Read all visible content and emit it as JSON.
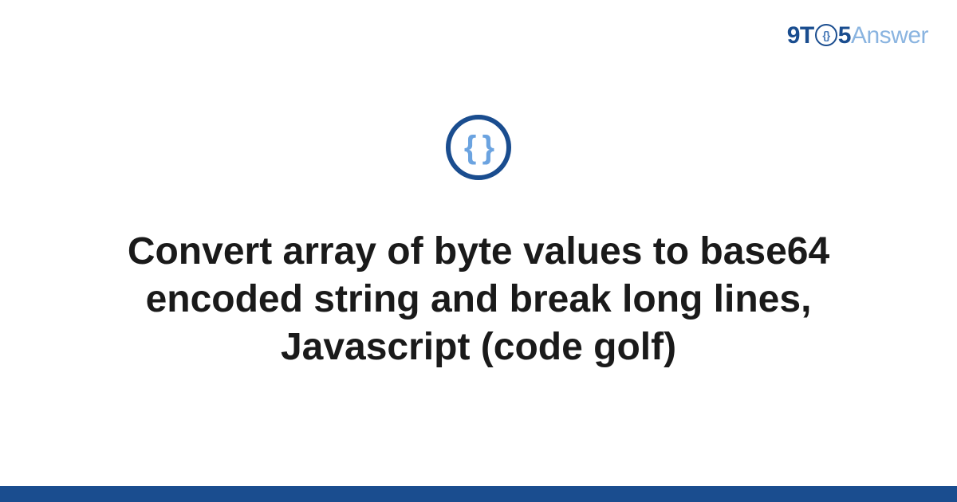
{
  "logo": {
    "part1": "9T",
    "circle_inner": "{}",
    "part2": "5",
    "part3": "Answer"
  },
  "icon": {
    "braces": "{ }"
  },
  "title": "Convert array of byte values to base64 encoded string and break long lines, Javascript (code golf)",
  "colors": {
    "primary": "#1a4d8f",
    "light_blue": "#8ab4e0",
    "brace_blue": "#6ba3e0"
  }
}
